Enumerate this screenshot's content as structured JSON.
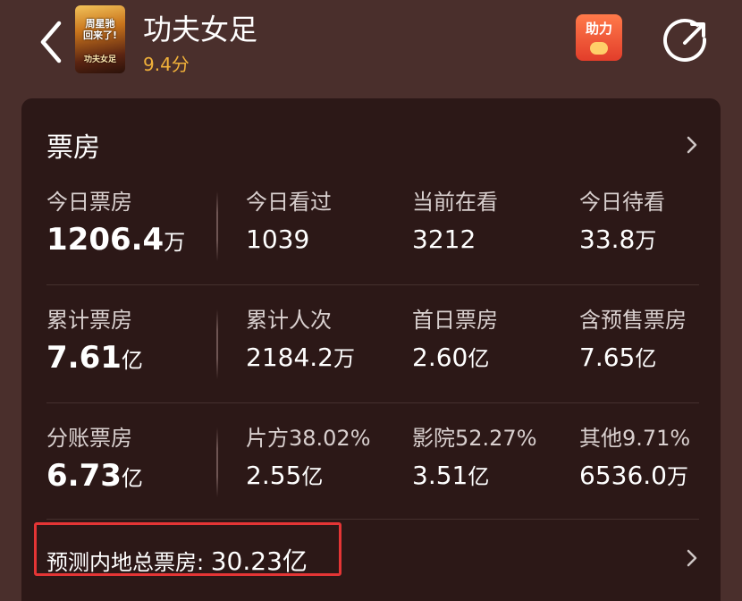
{
  "header": {
    "movie_title": "功夫女足",
    "score": "9.4分",
    "poster_text_line1": "周星驰",
    "poster_text_line2": "回来了!",
    "poster_brand": "功夫女足",
    "help_label": "助力"
  },
  "box_office": {
    "title": "票房",
    "rows": [
      [
        {
          "label": "今日票房",
          "value": "1206.4",
          "unit": "万"
        },
        {
          "label": "今日看过",
          "value": "1039",
          "unit": ""
        },
        {
          "label": "当前在看",
          "value": "3212",
          "unit": ""
        },
        {
          "label": "今日待看",
          "value": "33.8",
          "unit": "万"
        }
      ],
      [
        {
          "label": "累计票房",
          "value": "7.61",
          "unit": "亿"
        },
        {
          "label": "累计人次",
          "value": "2184.2",
          "unit": "万"
        },
        {
          "label": "首日票房",
          "value": "2.60",
          "unit": "亿"
        },
        {
          "label": "含预售票房",
          "value": "7.65",
          "unit": "亿"
        }
      ],
      [
        {
          "label": "分账票房",
          "value": "6.73",
          "unit": "亿"
        },
        {
          "label": "片方38.02%",
          "value": "2.55",
          "unit": "亿"
        },
        {
          "label": "影院52.27%",
          "value": "3.51",
          "unit": "亿"
        },
        {
          "label": "其他9.71%",
          "value": "6536.0",
          "unit": "万"
        }
      ]
    ],
    "forecast_label": "预测内地总票房:",
    "forecast_value": "30.23亿"
  },
  "colors": {
    "background": "#4a2f2c",
    "card": "#2c1817",
    "score": "#f1b13a",
    "highlight_border": "#e43535"
  },
  "icons": [
    "back-arrow-icon",
    "help-coin-icon",
    "share-icon",
    "chevron-right-icon"
  ]
}
